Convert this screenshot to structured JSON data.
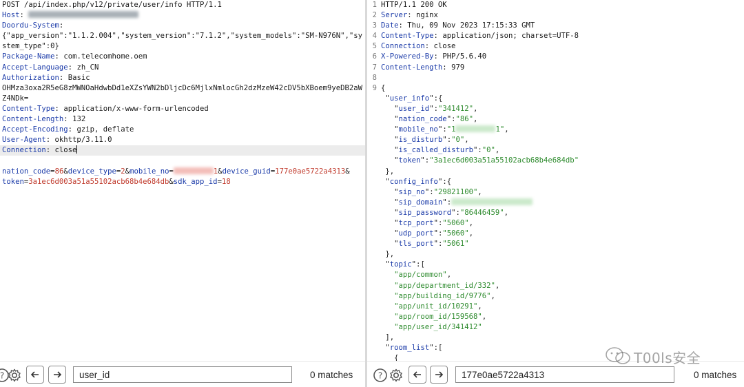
{
  "request": {
    "lines": [
      {
        "type": "plain",
        "text": "POST /api/index.php/v12/private/user/info HTTP/1.1"
      },
      {
        "type": "header-redacted",
        "key": "Host",
        "sep": ": "
      },
      {
        "type": "header-only",
        "key": "Doordu-System",
        "sep": ":"
      },
      {
        "type": "plain",
        "text": "{\"app_version\":\"1.1.2.004\",\"system_version\":\"7.1.2\",\"system_models\":\"SM-N976N\",\"sy"
      },
      {
        "type": "plain",
        "text": "stem_type\":0}"
      },
      {
        "type": "header",
        "key": "Package-Name",
        "sep": ": ",
        "value": "com.telecomhome.oem"
      },
      {
        "type": "header",
        "key": "Accept-Language",
        "sep": ": ",
        "value": "zh_CN"
      },
      {
        "type": "header",
        "key": "Authorization",
        "sep": ": ",
        "value": "Basic"
      },
      {
        "type": "plain",
        "text": "OHMza3oxa2R5eG8zMWNOaHdwbDd1eXZsYWN2bDljcDc6MjlxNmlocGh2dzMzeW42cDV5bXBoem9yeDB2aW"
      },
      {
        "type": "plain",
        "text": "Z4NDk="
      },
      {
        "type": "header",
        "key": "Content-Type",
        "sep": ": ",
        "value": "application/x-www-form-urlencoded"
      },
      {
        "type": "header",
        "key": "Content-Length",
        "sep": ": ",
        "value": "132"
      },
      {
        "type": "header",
        "key": "Accept-Encoding",
        "sep": ": ",
        "value": "gzip, deflate"
      },
      {
        "type": "header",
        "key": "User-Agent",
        "sep": ": ",
        "value": "okhttp/3.11.0"
      },
      {
        "type": "header-active",
        "key": "Connection",
        "sep": ": ",
        "value": "close"
      },
      {
        "type": "blank"
      },
      {
        "type": "body1"
      },
      {
        "type": "body2"
      }
    ],
    "body": {
      "nation_code_key": "nation_code",
      "nation_code_val": "86",
      "device_type_key": "device_type",
      "device_type_val": "2",
      "mobile_no_key": "mobile_no",
      "mobile_no_tail": "1",
      "device_guid_key": "device_guid",
      "device_guid_val": "177e0ae5722a4313",
      "token_key": "token",
      "token_val": "3a1ec6d003a51a55102acb68b4e684db",
      "sdk_app_id_key": "sdk_app_id",
      "sdk_app_id_val": "18"
    }
  },
  "response": {
    "lines": [
      {
        "n": "1",
        "type": "plain",
        "text": "HTTP/1.1 200 OK"
      },
      {
        "n": "2",
        "type": "header",
        "key": "Server",
        "value": "nginx"
      },
      {
        "n": "3",
        "type": "header",
        "key": "Date",
        "value": "Thu, 09 Nov 2023 17:15:33 GMT"
      },
      {
        "n": "4",
        "type": "header",
        "key": "Content-Type",
        "value": "application/json; charset=UTF-8"
      },
      {
        "n": "5",
        "type": "header",
        "key": "Connection",
        "value": "close"
      },
      {
        "n": "6",
        "type": "header",
        "key": "X-Powered-By",
        "value": "PHP/5.6.40"
      },
      {
        "n": "7",
        "type": "header",
        "key": "Content-Length",
        "value": "979"
      },
      {
        "n": "8",
        "type": "blank"
      },
      {
        "n": "9",
        "type": "plain",
        "text": "{"
      }
    ],
    "json_lines": [
      {
        "indent": 1,
        "key": "user_info",
        "open": "{"
      },
      {
        "indent": 2,
        "key": "user_id",
        "str": "341412",
        "comma": true
      },
      {
        "indent": 2,
        "key": "nation_code",
        "str": "86",
        "comma": true
      },
      {
        "indent": 2,
        "key": "mobile_no",
        "str_prefix": "1",
        "redacted": true,
        "str_suffix": "1",
        "comma": true
      },
      {
        "indent": 2,
        "key": "is_disturb",
        "str": "0",
        "comma": true
      },
      {
        "indent": 2,
        "key": "is_called_disturb",
        "str": "0",
        "comma": true
      },
      {
        "indent": 2,
        "key": "token",
        "str": "3a1ec6d003a51a55102acb68b4e684db",
        "comma": false
      },
      {
        "indent": 1,
        "close": "},"
      },
      {
        "indent": 1,
        "key": "config_info",
        "open": "{"
      },
      {
        "indent": 2,
        "key": "sip_no",
        "str": "29821100",
        "comma": true
      },
      {
        "indent": 2,
        "key": "sip_domain",
        "redacted_wide": true
      },
      {
        "indent": 2,
        "key": "sip_password",
        "str": "86446459",
        "comma": true
      },
      {
        "indent": 2,
        "key": "tcp_port",
        "str": "5060",
        "comma": true
      },
      {
        "indent": 2,
        "key": "udp_port",
        "str": "5060",
        "comma": true
      },
      {
        "indent": 2,
        "key": "tls_port",
        "str": "5061",
        "comma": false
      },
      {
        "indent": 1,
        "close": "},"
      },
      {
        "indent": 1,
        "key": "topic",
        "open": "["
      },
      {
        "indent": 2,
        "item": "app/common",
        "comma": true
      },
      {
        "indent": 2,
        "item": "app/department_id/332",
        "comma": true
      },
      {
        "indent": 2,
        "item": "app/building_id/9776",
        "comma": true
      },
      {
        "indent": 2,
        "item": "app/unit_id/10291",
        "comma": true
      },
      {
        "indent": 2,
        "item": "app/room_id/159568",
        "comma": true
      },
      {
        "indent": 2,
        "item": "app/user_id/341412",
        "comma": false
      },
      {
        "indent": 1,
        "close": "],"
      },
      {
        "indent": 1,
        "key": "room_list",
        "open": "["
      },
      {
        "indent": 2,
        "close": "{"
      }
    ]
  },
  "left_toolbar": {
    "search_value": "user_id",
    "matches": "0 matches"
  },
  "right_toolbar": {
    "search_value": "177e0ae5722a4313",
    "matches": "0 matches"
  },
  "watermark": {
    "text": "T00ls安全"
  },
  "colors": {
    "header_key": "#1a3aa8",
    "param_value": "#c0392b",
    "json_string": "#2e8b2e"
  }
}
